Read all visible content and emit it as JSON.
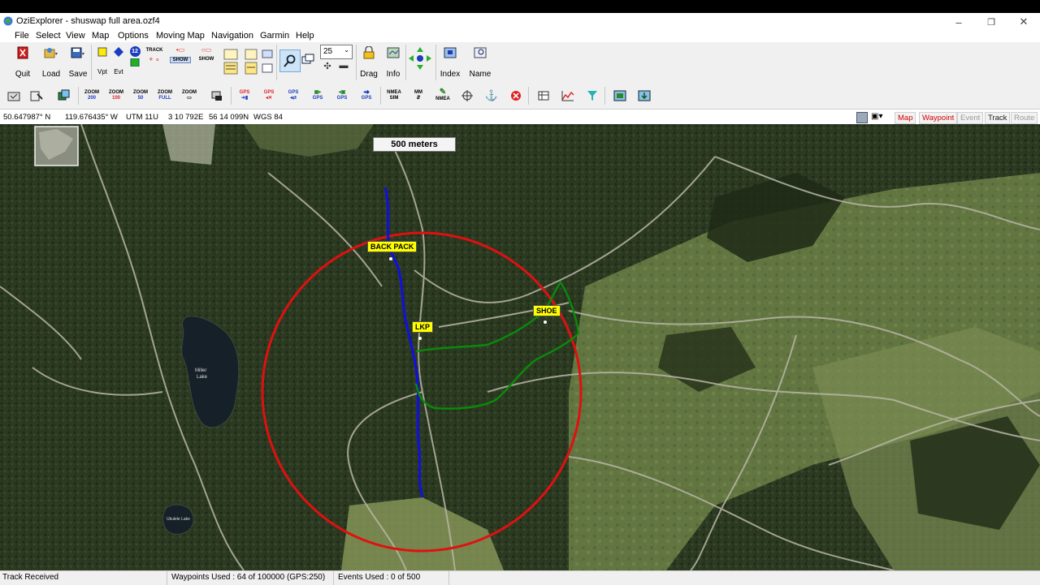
{
  "window": {
    "title": "OziExplorer - shuswap full area.ozf4",
    "controls": {
      "minimize": "–",
      "maximize": "❐",
      "close": "✕"
    }
  },
  "menu": [
    "File",
    "Select",
    "View",
    "Map",
    "Options",
    "Moving Map",
    "Navigation",
    "Garmin",
    "Help"
  ],
  "toolbar1": {
    "quit": "Quit",
    "load": "Load",
    "save": "Save",
    "vpt": "Vpt",
    "evt": "Evt",
    "track_badge": "12",
    "track": "TRACK",
    "show": "SHOW",
    "show2": "SHOW",
    "zoom_value": "25",
    "drag": "Drag",
    "info": "Info",
    "index": "Index",
    "name": "Name"
  },
  "toolbar2": {
    "zoom200": [
      "ZOOM",
      "200"
    ],
    "zoom100": [
      "ZOOM",
      "100"
    ],
    "zoom50": [
      "ZOOM",
      "50"
    ],
    "zoomfull": [
      "ZOOM",
      "FULL"
    ],
    "zoom": [
      "ZOOM",
      ""
    ],
    "gps": "GPS",
    "nmea": "NMEA",
    "sim": "SIM",
    "mm": "MM"
  },
  "coords": {
    "lat": "50.647987° N",
    "lon": "119.676435° W",
    "utm": "UTM  11U",
    "easting": "3 10 792E",
    "northing": "56 14 099N",
    "datum": "WGS 84"
  },
  "mode_buttons": [
    {
      "label": "Map",
      "color": "#d40000"
    },
    {
      "label": "Waypoint",
      "color": "#d40000"
    },
    {
      "label": "Event",
      "color": "#9a9a9a"
    },
    {
      "label": "Track",
      "color": "#202020"
    },
    {
      "label": "Route",
      "color": "#9a9a9a"
    }
  ],
  "map": {
    "scale_label": "500 meters",
    "waypoints": [
      "BACK PACK",
      "LKP",
      "SHOE"
    ],
    "lake_labels": [
      "Miller",
      "Lake",
      "Ukulele Lake"
    ],
    "colors": {
      "circle": "#e01010",
      "track_blue": "#1010e0",
      "track_green": "#0a8a0a",
      "waypoint_bg": "#ffff00",
      "forest": "#2e3d22",
      "meadow": "#6f8448"
    }
  },
  "status": {
    "left": "Track Received",
    "waypoints": "Waypoints Used : 64 of 100000  (GPS:250)",
    "events": "Events Used : 0 of 500"
  }
}
